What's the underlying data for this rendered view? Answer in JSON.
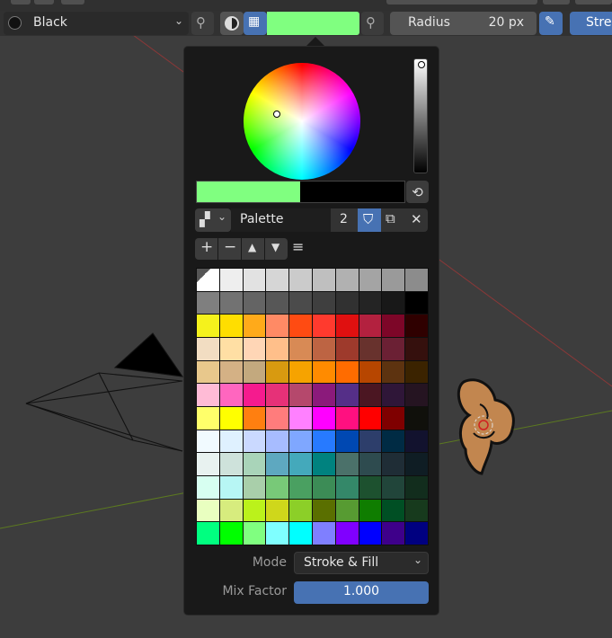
{
  "header": {
    "material_name": "Black",
    "radius_label": "Radius",
    "radius_value": "20 px",
    "strength_label": "Stre",
    "active_color": "#80ff80"
  },
  "popup": {
    "current_color": "#80ff80",
    "previous_color": "#000000",
    "palette_name": "Palette",
    "palette_users": "2",
    "mode_label": "Mode",
    "mode_value": "Stroke & Fill",
    "mix_factor_label": "Mix Factor",
    "mix_factor_value": "1.000"
  },
  "palette_colors": [
    [
      "#ffffff",
      "#eeeeee",
      "#e2e2e2",
      "#d6d6d6",
      "#cbcbcb",
      "#bfbfbf",
      "#b1b1b1",
      "#a4a4a4",
      "#9a9a9a",
      "#8c8c8c"
    ],
    [
      "#7f7f7f",
      "#727272",
      "#646464",
      "#575757",
      "#4b4b4b",
      "#3f3f3f",
      "#313131",
      "#242424",
      "#181818",
      "#000000"
    ],
    [
      "#f5f21c",
      "#ffde00",
      "#ffaa1a",
      "#ff8a65",
      "#ff4b12",
      "#ff3a2e",
      "#e01010",
      "#b3213f",
      "#7d0628",
      "#2f0000"
    ],
    [
      "#f2ddc2",
      "#ffdfa4",
      "#ffd6b6",
      "#ffbf8a",
      "#d88a55",
      "#bd6443",
      "#9e3a2c",
      "#68322d",
      "#6b2034",
      "#35100d"
    ],
    [
      "#e8c88c",
      "#d4b185",
      "#c3a97e",
      "#d89a10",
      "#f6a300",
      "#ff8b00",
      "#ff6c00",
      "#b74600",
      "#5d3310",
      "#3b2300"
    ],
    [
      "#ffbbd6",
      "#ff66bf",
      "#f51b8e",
      "#e63178",
      "#b5486c",
      "#8b1a7b",
      "#552f88",
      "#4b1622",
      "#2f1638",
      "#251421"
    ],
    [
      "#ffff6a",
      "#ffff00",
      "#ff7f10",
      "#ff7c7c",
      "#ff80ff",
      "#ff00ff",
      "#ff1080",
      "#ff0000",
      "#7f0000",
      "#10100b"
    ],
    [
      "#f1faff",
      "#dff1ff",
      "#cad9ff",
      "#a7bcff",
      "#7fa7ff",
      "#277aff",
      "#0048b2",
      "#2d3e6b",
      "#002b44",
      "#12122e"
    ],
    [
      "#e8f2f0",
      "#cee2db",
      "#a9d4b9",
      "#5ea8c0",
      "#44a9bb",
      "#00827f",
      "#4b716a",
      "#2e4b4f",
      "#1f2d36",
      "#0f1d24"
    ],
    [
      "#d7fff1",
      "#b7f6f4",
      "#a9cfaa",
      "#78c978",
      "#4aa061",
      "#3c8c56",
      "#348869",
      "#1d512f",
      "#21453a",
      "#122d1d"
    ],
    [
      "#e9ffc0",
      "#d7ec7e",
      "#bbf21b",
      "#cfd71b",
      "#8ccf28",
      "#5a6f00",
      "#579b32",
      "#0f7d00",
      "#004f24",
      "#173a1d"
    ],
    [
      "#00ff80",
      "#00ff00",
      "#80ff80",
      "#7fffff",
      "#00ffff",
      "#7f7fff",
      "#8000ff",
      "#0000ff",
      "#3e008a",
      "#000080"
    ]
  ]
}
